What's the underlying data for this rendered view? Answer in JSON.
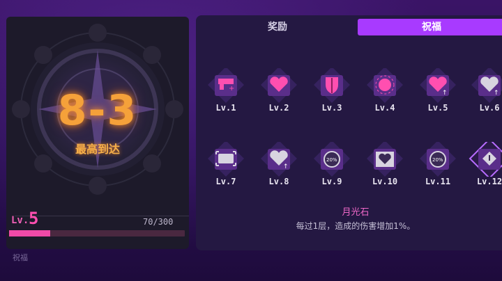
{
  "stage": {
    "value": "8-3",
    "caption": "最高到达"
  },
  "player": {
    "lv_prefix": "Lv.",
    "level": "5",
    "exp_text": "70/300",
    "exp_fraction": 0.233
  },
  "tabs": [
    {
      "label": "奖励",
      "active": false
    },
    {
      "label": "祝福",
      "active": true
    }
  ],
  "blessings": [
    {
      "label": "Lv.1",
      "icon": "gun-plus-icon",
      "selected": false
    },
    {
      "label": "Lv.2",
      "icon": "heart-sparkle-icon",
      "selected": false
    },
    {
      "label": "Lv.3",
      "icon": "shield-icon",
      "selected": false
    },
    {
      "label": "Lv.4",
      "icon": "coin-sun-icon",
      "selected": false
    },
    {
      "label": "Lv.5",
      "icon": "heart-up-icon",
      "selected": false
    },
    {
      "label": "Lv.6",
      "icon": "heart-up-gray-icon",
      "selected": false
    },
    {
      "label": "Lv.7",
      "icon": "bullet-frame-icon",
      "selected": false
    },
    {
      "label": "Lv.8",
      "icon": "heart-outline-up-icon",
      "selected": false
    },
    {
      "label": "Lv.9",
      "icon": "timer-20-icon",
      "selected": false
    },
    {
      "label": "Lv.10",
      "icon": "heart-card-icon",
      "selected": false
    },
    {
      "label": "Lv.11",
      "icon": "timer-20-half-icon",
      "selected": false
    },
    {
      "label": "Lv.12",
      "icon": "moonstone-icon",
      "selected": true
    }
  ],
  "selected_blessing": {
    "name": "月光石",
    "description": "每过1层，造成的伤害增加1%。"
  },
  "footer": {
    "text": "祝福"
  },
  "colors": {
    "accent": "#a83aff",
    "stage": "#f5a13a",
    "level": "#ff4fb0",
    "bar": "#f04aa8"
  }
}
